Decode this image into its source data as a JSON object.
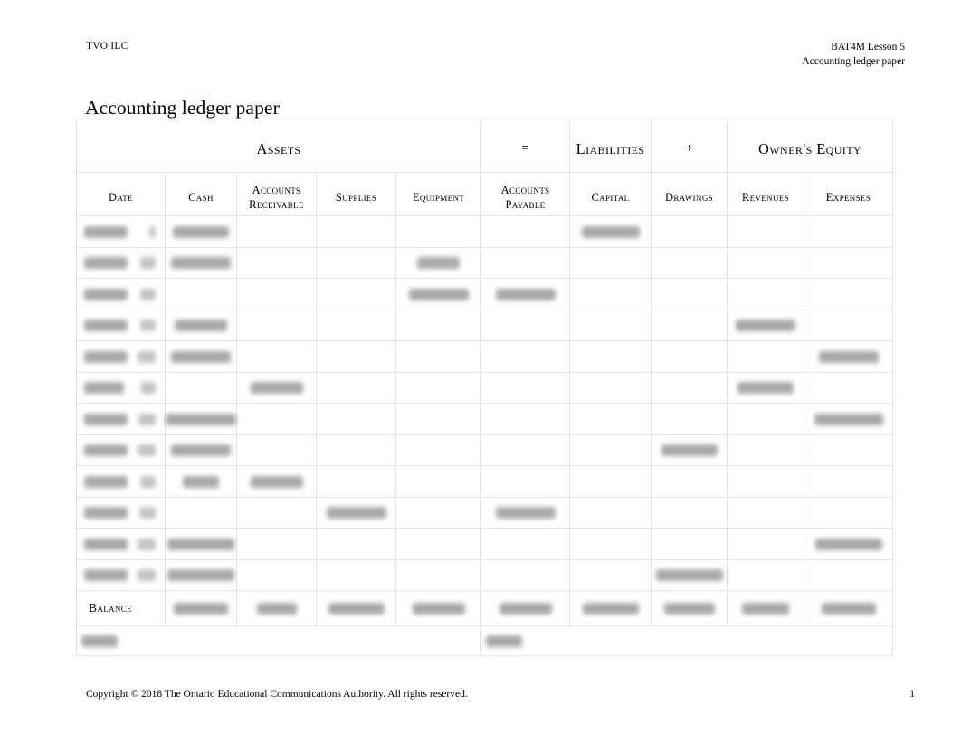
{
  "runhead": {
    "left": "TVO ILC",
    "right_line1": "BAT4M Lesson 5",
    "right_line2": "Accounting ledger paper"
  },
  "title": "Accounting ledger paper",
  "ledger": {
    "group_headers": [
      {
        "label": "Assets",
        "span": 5
      },
      {
        "label": "=",
        "span": 1
      },
      {
        "label": "Liabilities",
        "span": 1
      },
      {
        "label": "+",
        "span": 1
      },
      {
        "label": "Owner's Equity",
        "span": 4
      }
    ],
    "columns": [
      {
        "label": "Date",
        "line2": ""
      },
      {
        "label": "Cash",
        "line2": ""
      },
      {
        "label": "Accounts",
        "line2": "Receivable"
      },
      {
        "label": "Supplies",
        "line2": ""
      },
      {
        "label": "Equipment",
        "line2": ""
      },
      {
        "label": "Accounts",
        "line2": "Payable"
      },
      {
        "label": "Capital",
        "line2": ""
      },
      {
        "label": "Drawings",
        "line2": ""
      },
      {
        "label": "Revenues",
        "line2": ""
      },
      {
        "label": "Expenses",
        "line2": ""
      }
    ],
    "balance_label": "Balance",
    "rows": [
      {
        "date_month": 48,
        "date_day": 7,
        "cash": 62,
        "ar": 0,
        "sup": 0,
        "eq": 0,
        "ap": 0,
        "cap": 64,
        "dr": 0,
        "rev": 0,
        "exp": 0
      },
      {
        "date_month": 48,
        "date_day": 17,
        "cash": 66,
        "ar": 0,
        "sup": 0,
        "eq": 47,
        "ap": 0,
        "cap": 0,
        "dr": 0,
        "rev": 0,
        "exp": 0
      },
      {
        "date_month": 48,
        "date_day": 17,
        "cash": 0,
        "ar": 0,
        "sup": 0,
        "eq": 66,
        "ap": 66,
        "cap": 0,
        "dr": 0,
        "rev": 0,
        "exp": 0
      },
      {
        "date_month": 48,
        "date_day": 17,
        "cash": 58,
        "ar": 0,
        "sup": 0,
        "eq": 0,
        "ap": 0,
        "cap": 0,
        "dr": 0,
        "rev": 66,
        "exp": 0
      },
      {
        "date_month": 48,
        "date_day": 20,
        "cash": 66,
        "ar": 0,
        "sup": 0,
        "eq": 0,
        "ap": 0,
        "cap": 0,
        "dr": 0,
        "rev": 0,
        "exp": 66
      },
      {
        "date_month": 44,
        "date_day": 16,
        "cash": 0,
        "ar": 58,
        "sup": 0,
        "eq": 0,
        "ap": 0,
        "cap": 0,
        "dr": 0,
        "rev": 62,
        "exp": 0
      },
      {
        "date_month": 48,
        "date_day": 19,
        "cash": 78,
        "ar": 0,
        "sup": 0,
        "eq": 0,
        "ap": 0,
        "cap": 0,
        "dr": 0,
        "rev": 0,
        "exp": 76
      },
      {
        "date_month": 48,
        "date_day": 20,
        "cash": 66,
        "ar": 0,
        "sup": 0,
        "eq": 0,
        "ap": 0,
        "cap": 0,
        "dr": 62,
        "rev": 0,
        "exp": 0
      },
      {
        "date_month": 48,
        "date_day": 17,
        "cash": 40,
        "ar": 58,
        "sup": 0,
        "eq": 0,
        "ap": 0,
        "cap": 0,
        "dr": 0,
        "rev": 0,
        "exp": 0
      },
      {
        "date_month": 48,
        "date_day": 18,
        "cash": 0,
        "ar": 0,
        "sup": 66,
        "eq": 0,
        "ap": 66,
        "cap": 0,
        "dr": 0,
        "rev": 0,
        "exp": 0
      },
      {
        "date_month": 48,
        "date_day": 20,
        "cash": 74,
        "ar": 0,
        "sup": 0,
        "eq": 0,
        "ap": 0,
        "cap": 0,
        "dr": 0,
        "rev": 0,
        "exp": 74
      },
      {
        "date_month": 48,
        "date_day": 20,
        "cash": 74,
        "ar": 0,
        "sup": 0,
        "eq": 0,
        "ap": 0,
        "cap": 0,
        "dr": 74,
        "rev": 0,
        "exp": 0
      }
    ],
    "balance": {
      "cash": 60,
      "ar": 44,
      "sup": 62,
      "eq": 58,
      "ap": 58,
      "cap": 62,
      "dr": 56,
      "rev": 52,
      "exp": 60
    },
    "tail": {
      "left_block": 40,
      "mid_block": 40
    }
  },
  "footer": {
    "copyright": "Copyright © 2018 The Ontario Educational Communications Authority. All rights reserved.",
    "page_number": "1"
  },
  "colors": {
    "border": "#e3e3e3",
    "text": "#000000",
    "redaction": "#9d9d9d"
  }
}
